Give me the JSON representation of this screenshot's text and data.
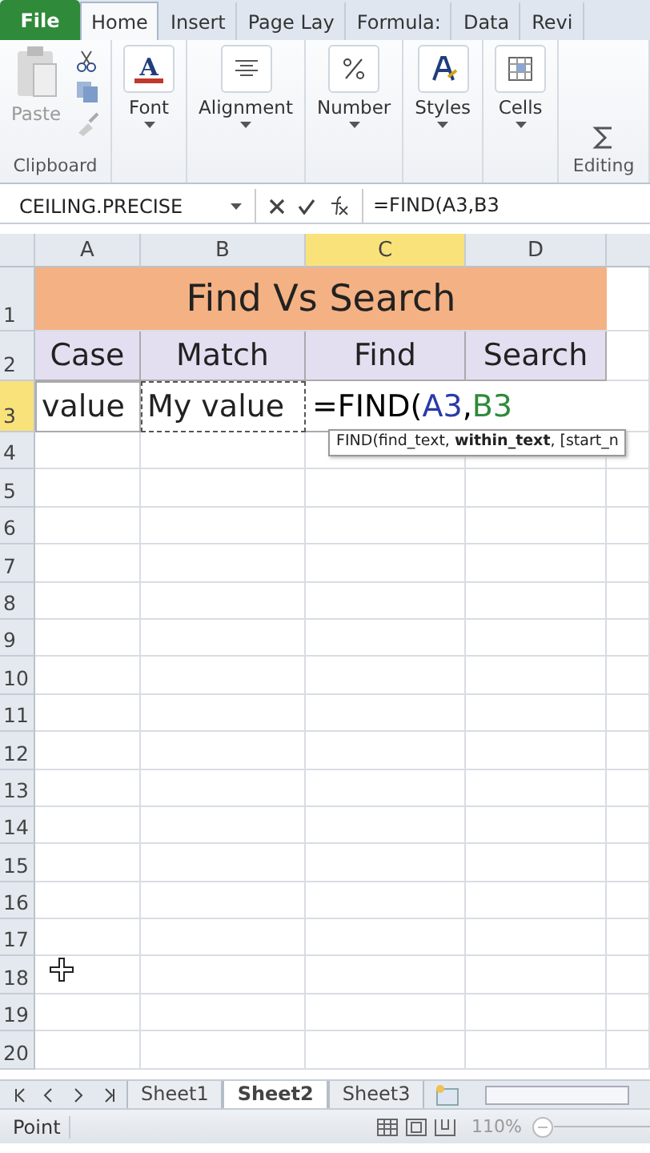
{
  "ribbon": {
    "tabs": [
      {
        "label": "File",
        "kind": "file",
        "selected": false
      },
      {
        "label": "Home",
        "kind": "tab",
        "selected": true
      },
      {
        "label": "Insert",
        "kind": "tab",
        "selected": false
      },
      {
        "label": "Page Lay",
        "kind": "tab",
        "selected": false
      },
      {
        "label": "Formula:",
        "kind": "tab",
        "selected": false
      },
      {
        "label": "Data",
        "kind": "tab",
        "selected": false
      },
      {
        "label": "Revi",
        "kind": "tab",
        "selected": false
      }
    ],
    "clipboard": {
      "paste": "Paste",
      "label": "Clipboard"
    },
    "buttons": [
      {
        "label": "Font",
        "kind": "font",
        "glyph": "A"
      },
      {
        "label": "Alignment",
        "kind": "align"
      },
      {
        "label": "Number",
        "kind": "number"
      },
      {
        "label": "Styles",
        "kind": "styles"
      },
      {
        "label": "Cells",
        "kind": "cells"
      }
    ],
    "editing": {
      "label": "Editing"
    }
  },
  "formula_bar": {
    "name_box": "CEILING.PRECISE",
    "value": "=FIND(A3,B3"
  },
  "sheet": {
    "columns": [
      {
        "label": "A",
        "selected": false
      },
      {
        "label": "B",
        "selected": false
      },
      {
        "label": "C",
        "selected": true
      },
      {
        "label": "D",
        "selected": false
      }
    ],
    "rows": [
      {
        "label": "1",
        "selected": false
      },
      {
        "label": "2",
        "selected": false
      },
      {
        "label": "3",
        "selected": true
      },
      {
        "label": "4",
        "selected": false
      },
      {
        "label": "5",
        "selected": false
      },
      {
        "label": "6",
        "selected": false
      },
      {
        "label": "7",
        "selected": false
      },
      {
        "label": "8",
        "selected": false
      },
      {
        "label": "9",
        "selected": false
      },
      {
        "label": "10",
        "selected": false
      },
      {
        "label": "11",
        "selected": false
      },
      {
        "label": "12",
        "selected": false
      },
      {
        "label": "13",
        "selected": false
      },
      {
        "label": "14",
        "selected": false
      },
      {
        "label": "15",
        "selected": false
      },
      {
        "label": "16",
        "selected": false
      },
      {
        "label": "17",
        "selected": false
      },
      {
        "label": "18",
        "selected": false
      },
      {
        "label": "19",
        "selected": false
      },
      {
        "label": "20",
        "selected": false
      }
    ],
    "title": "Find Vs Search",
    "headers": [
      "Case",
      "Match",
      "Find",
      "Search"
    ],
    "row3": [
      "value",
      "My value"
    ],
    "formula": {
      "function": "=FIND(",
      "separator": ",",
      "args": [
        {
          "text": "A3",
          "color": "#2a3aa8"
        },
        {
          "text": "B3",
          "color": "#2e8b3a"
        }
      ]
    },
    "tooltip": "FIND(find_text, **within_text**, [start_n"
  },
  "sheet_tabs": [
    {
      "label": "Sheet1",
      "selected": false
    },
    {
      "label": "Sheet2",
      "selected": true
    },
    {
      "label": "Sheet3",
      "selected": false
    }
  ],
  "status_bar": {
    "mode": "Point",
    "zoom": "110%"
  }
}
